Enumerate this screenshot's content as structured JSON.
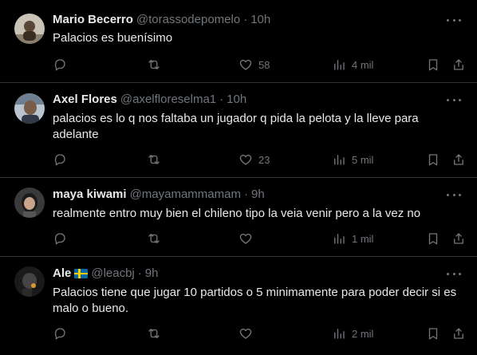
{
  "tweets": [
    {
      "name": "Mario Becerro",
      "handle": "@torassodepomelo",
      "time": "10h",
      "text": "Palacios es buenísimo",
      "reply_count": "",
      "retweet_count": "",
      "like_count": "58",
      "views": "4 mil",
      "flag": false
    },
    {
      "name": "Axel Flores",
      "handle": "@axelfloreselma1",
      "time": "10h",
      "text": "palacios es lo q nos faltaba un jugador q pida la pelota y la lleve para adelante",
      "reply_count": "",
      "retweet_count": "",
      "like_count": "23",
      "views": "5 mil",
      "flag": false
    },
    {
      "name": "maya kiwami",
      "handle": "@mayamammamam",
      "time": "9h",
      "text": "realmente entro muy bien el chileno tipo la veia venir pero a la vez no",
      "reply_count": "",
      "retweet_count": "",
      "like_count": "",
      "views": "1 mil",
      "flag": false
    },
    {
      "name": "Ale",
      "handle": "@leacbj",
      "time": "9h",
      "text": "Palacios tiene que jugar 10 partidos o 5 minimamente para poder decir si es malo o bueno.",
      "reply_count": "",
      "retweet_count": "",
      "like_count": "",
      "views": "2 mil",
      "flag": true
    }
  ],
  "separator": "·",
  "icons": [
    "reply-icon",
    "retweet-icon",
    "like-icon",
    "views-icon",
    "bookmark-icon",
    "share-icon",
    "more-icon"
  ],
  "colors": {
    "background": "#000000",
    "text": "#e7e9ea",
    "muted": "#71767b",
    "border": "#2f3336"
  }
}
